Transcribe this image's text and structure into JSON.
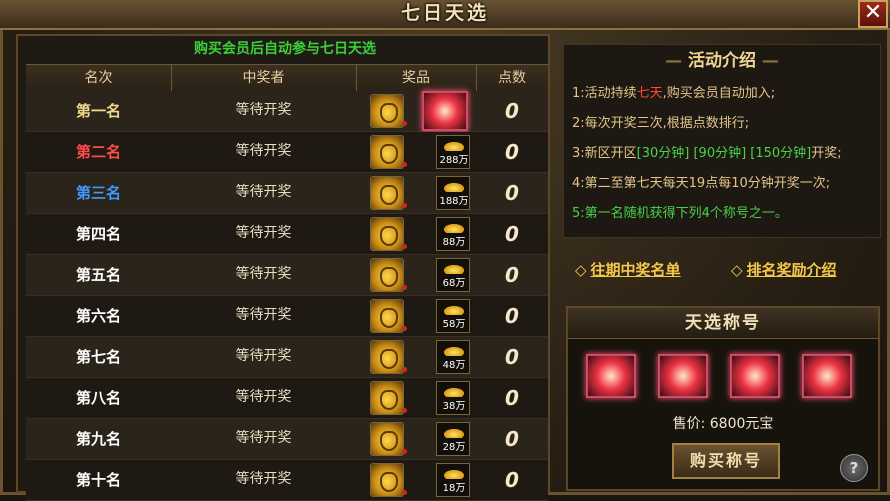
{
  "window": {
    "title": "七日天选",
    "close_label": "✕"
  },
  "notice": "购买会员后自动参与七日天选",
  "columns": [
    "名次",
    "中奖者",
    "奖品",
    "点数"
  ],
  "rows": [
    {
      "rank": "第一名",
      "rank_color": "#f0d98a",
      "winner": "等待开奖",
      "gold_amount": "",
      "prize_type": "title",
      "points": "0"
    },
    {
      "rank": "第二名",
      "rank_color": "#ff4b4b",
      "winner": "等待开奖",
      "gold_amount": "288万",
      "prize_type": "gold",
      "points": "0"
    },
    {
      "rank": "第三名",
      "rank_color": "#3f9bff",
      "winner": "等待开奖",
      "gold_amount": "188万",
      "prize_type": "gold",
      "points": "0"
    },
    {
      "rank": "第四名",
      "rank_color": "#ffffff",
      "winner": "等待开奖",
      "gold_amount": "88万",
      "prize_type": "gold",
      "points": "0"
    },
    {
      "rank": "第五名",
      "rank_color": "#ffffff",
      "winner": "等待开奖",
      "gold_amount": "68万",
      "prize_type": "gold",
      "points": "0"
    },
    {
      "rank": "第六名",
      "rank_color": "#ffffff",
      "winner": "等待开奖",
      "gold_amount": "58万",
      "prize_type": "gold",
      "points": "0"
    },
    {
      "rank": "第七名",
      "rank_color": "#ffffff",
      "winner": "等待开奖",
      "gold_amount": "48万",
      "prize_type": "gold",
      "points": "0"
    },
    {
      "rank": "第八名",
      "rank_color": "#ffffff",
      "winner": "等待开奖",
      "gold_amount": "38万",
      "prize_type": "gold",
      "points": "0"
    },
    {
      "rank": "第九名",
      "rank_color": "#ffffff",
      "winner": "等待开奖",
      "gold_amount": "28万",
      "prize_type": "gold",
      "points": "0"
    },
    {
      "rank": "第十名",
      "rank_color": "#ffffff",
      "winner": "等待开奖",
      "gold_amount": "18万",
      "prize_type": "gold",
      "points": "0"
    }
  ],
  "activity": {
    "title": "活动介绍",
    "rule1_a": "1:活动持续",
    "rule1_b": "七天",
    "rule1_c": ",购买会员自动加入;",
    "rule2": "2:每次开奖三次,根据点数排行;",
    "rule3_a": "3:新区开区",
    "rule3_b": "[30分钟] [90分钟] [150分钟]",
    "rule3_c": "开奖;",
    "rule4": "4:第二至第七天每天19点每10分钟开奖一次;",
    "rule5": "5:第一名随机获得下列4个称号之一。"
  },
  "links": {
    "history": "往期中奖名单",
    "rank_rewards": "排名奖励介绍"
  },
  "title_shop": {
    "title": "天选称号",
    "price": "售价:  6800元宝",
    "buy_label": "购买称号",
    "help_label": "?"
  }
}
